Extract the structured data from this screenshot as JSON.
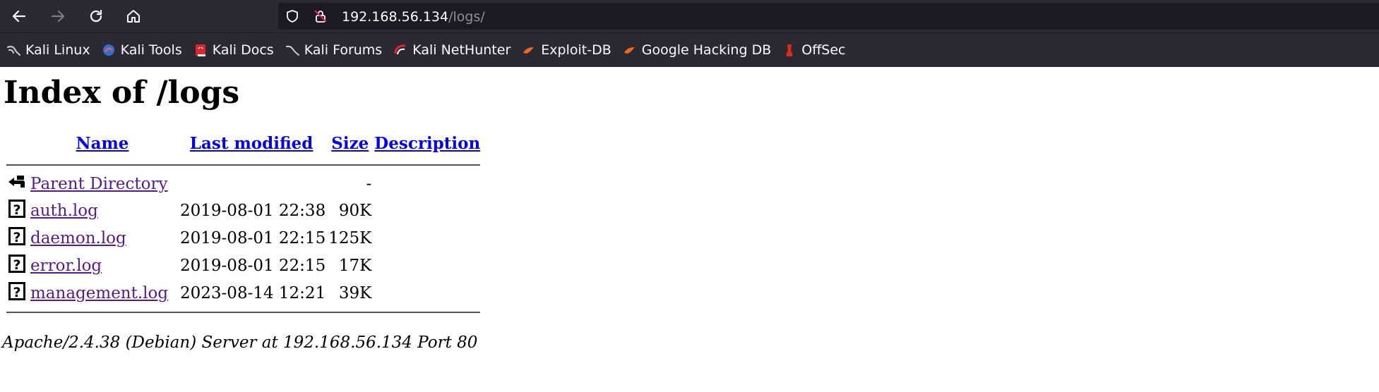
{
  "browser": {
    "url_host": "192.168.56.134",
    "url_path": "/logs/",
    "bookmarks": [
      {
        "label": "Kali Linux",
        "icon": "kali-dragon-icon"
      },
      {
        "label": "Kali Tools",
        "icon": "kali-tools-icon"
      },
      {
        "label": "Kali Docs",
        "icon": "kali-docs-icon"
      },
      {
        "label": "Kali Forums",
        "icon": "kali-forums-icon"
      },
      {
        "label": "Kali NetHunter",
        "icon": "kali-nethunter-icon"
      },
      {
        "label": "Exploit-DB",
        "icon": "exploit-db-icon"
      },
      {
        "label": "Google Hacking DB",
        "icon": "google-hacking-db-icon"
      },
      {
        "label": "OffSec",
        "icon": "offsec-icon"
      }
    ]
  },
  "page": {
    "title": "Index of /logs",
    "columns": {
      "name": "Name",
      "last_modified": "Last modified",
      "size": "Size",
      "description": "Description"
    },
    "parent": {
      "name": "Parent Directory",
      "size": "-"
    },
    "rows": [
      {
        "name": "auth.log",
        "modified": "2019-08-01 22:38",
        "size": "90K"
      },
      {
        "name": "daemon.log",
        "modified": "2019-08-01 22:15",
        "size": "125K"
      },
      {
        "name": "error.log",
        "modified": "2019-08-01 22:15",
        "size": "17K"
      },
      {
        "name": "management.log",
        "modified": "2023-08-14 12:21",
        "size": "39K"
      }
    ],
    "footer": "Apache/2.4.38 (Debian) Server at 192.168.56.134 Port 80"
  }
}
